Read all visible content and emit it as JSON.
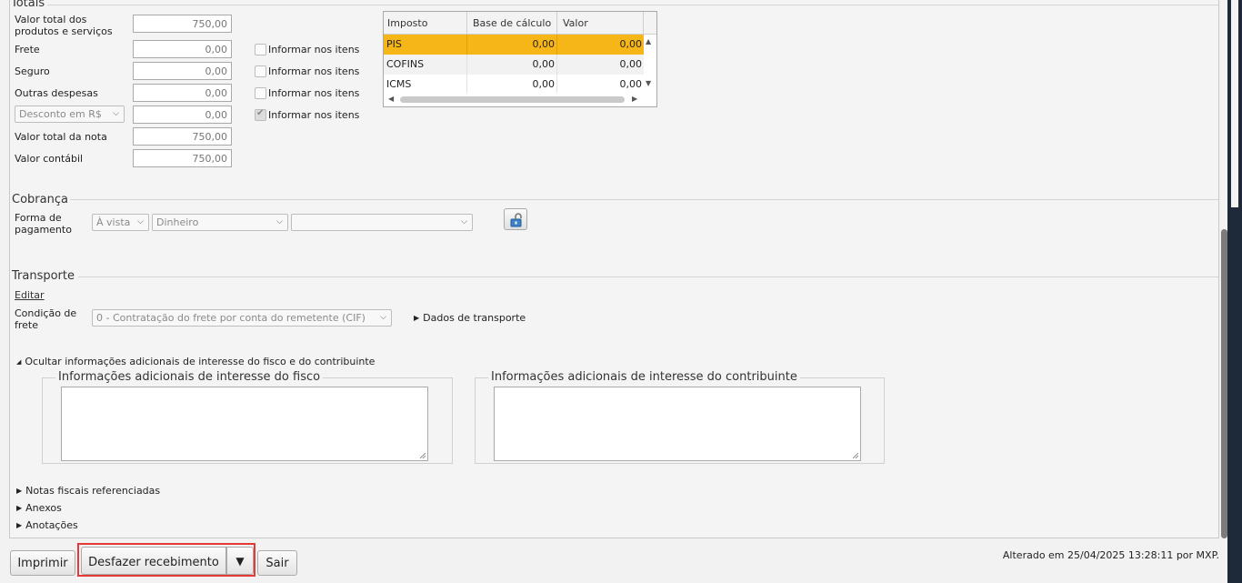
{
  "totais": {
    "title": "Totais",
    "rows": [
      {
        "label": "Valor total dos produtos e serviços",
        "value": "750,00"
      },
      {
        "label": "Frete",
        "value": "0,00",
        "check_label": "Informar nos itens"
      },
      {
        "label": "Seguro",
        "value": "0,00",
        "check_label": "Informar nos itens"
      },
      {
        "label": "Outras despesas",
        "value": "0,00",
        "check_label": "Informar nos itens"
      },
      {
        "label": "Desconto em R$",
        "value": "0,00",
        "check_label": "Informar nos itens"
      },
      {
        "label": "Valor total da nota",
        "value": "750,00"
      },
      {
        "label": "Valor contábil",
        "value": "750,00"
      }
    ]
  },
  "tax_grid": {
    "headers": [
      "Imposto",
      "Base de cálculo",
      "Valor"
    ],
    "rows": [
      {
        "imposto": "PIS",
        "base": "0,00",
        "valor": "0,00"
      },
      {
        "imposto": "COFINS",
        "base": "0,00",
        "valor": "0,00"
      },
      {
        "imposto": "ICMS",
        "base": "0,00",
        "valor": "0,00"
      }
    ],
    "selected_color": "#f7b618"
  },
  "cobranca": {
    "title": "Cobrança",
    "label": "Forma de pagamento",
    "condicao": "À vista",
    "meio": "Dinheiro",
    "extra": ""
  },
  "transporte": {
    "title": "Transporte",
    "edit_link": "Editar",
    "label": "Condição de frete",
    "condicao": "0 - Contratação do frete por conta do remetente (CIF)",
    "dados_toggle": "Dados de transporte"
  },
  "adicionais": {
    "toggle": "Ocultar informações adicionais de interesse do fisco e do contribuinte",
    "fisco_legend": "Informações adicionais de interesse do fisco",
    "fisco_text": "",
    "contribuinte_legend": "Informações adicionais de interesse do contribuinte",
    "contribuinte_text": ""
  },
  "collapsibles": [
    "Notas fiscais referenciadas",
    "Anexos",
    "Anotações"
  ],
  "footer": {
    "print_label": "Imprimir",
    "undo_label": "Desfazer recebimento",
    "dropdown_glyph": "▼",
    "exit_label": "Sair",
    "status": "Alterado em 25/04/2025 13:28:11 por MXP."
  },
  "colors": {
    "highlight": "#e53935",
    "accent": "#f7b618"
  }
}
